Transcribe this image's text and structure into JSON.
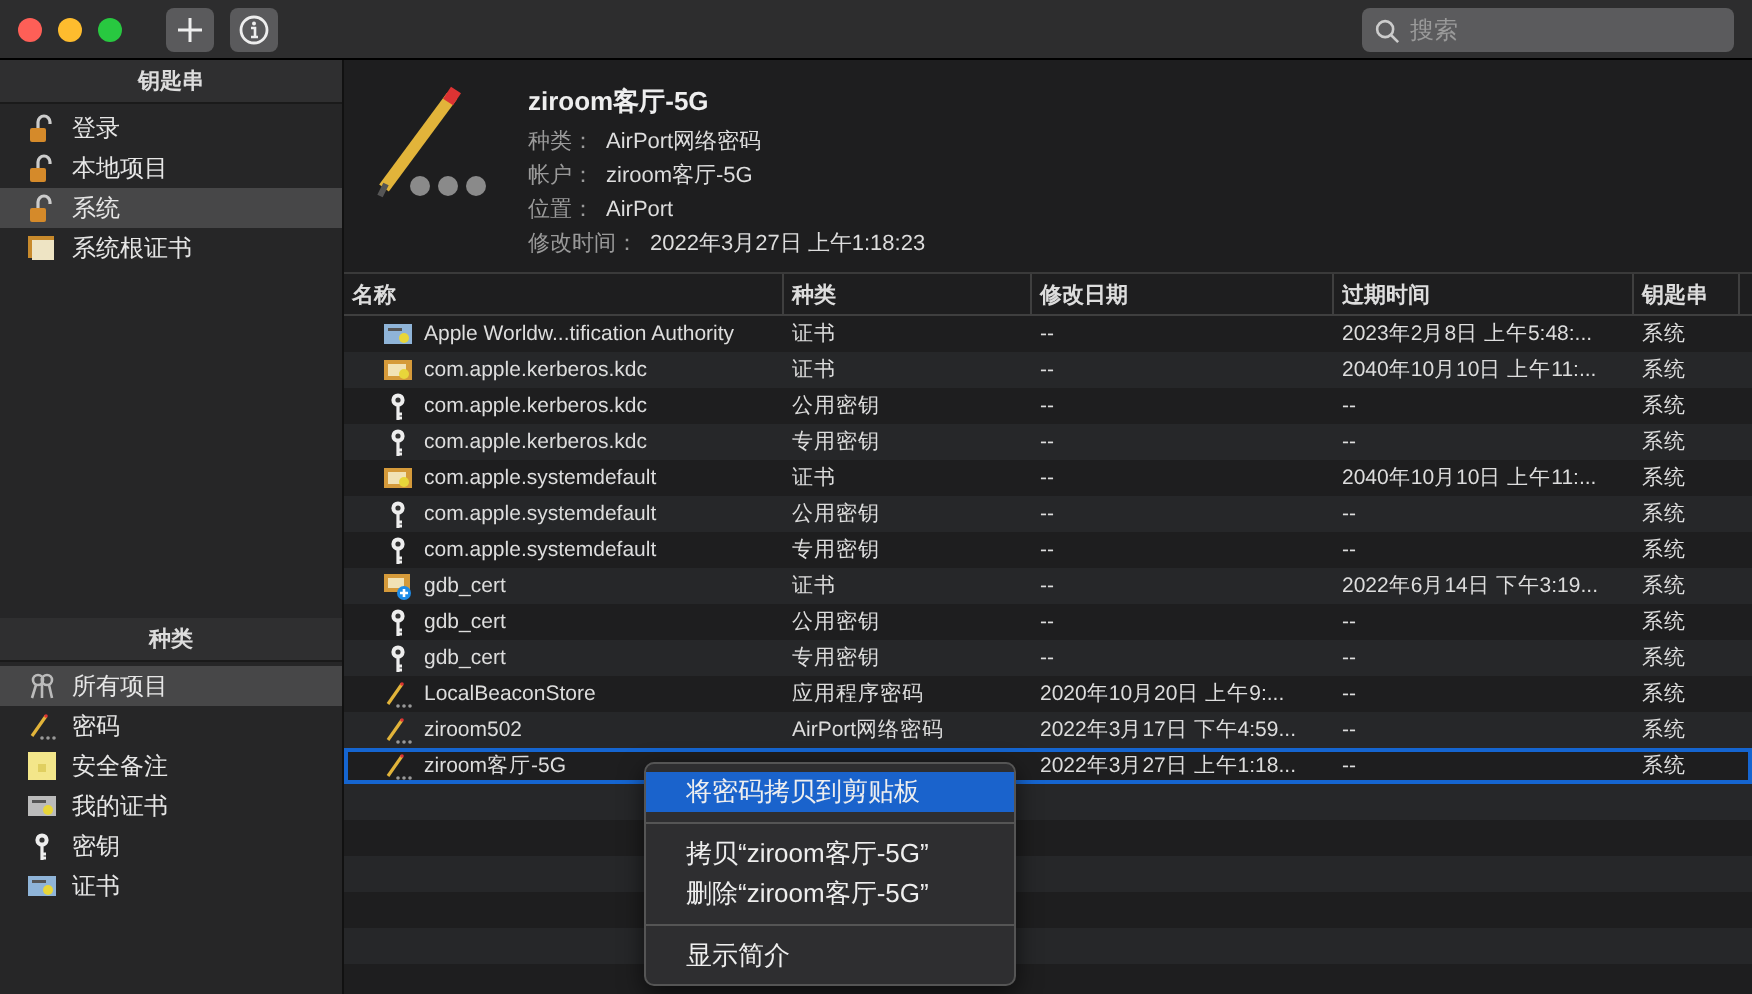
{
  "toolbar": {
    "buttons": [
      {
        "kind": "add"
      },
      {
        "kind": "info"
      }
    ],
    "search": {
      "placeholder": "搜索"
    }
  },
  "keychains": {
    "title": "钥匙串",
    "items": [
      {
        "label": "登录",
        "kind": "lock",
        "selected": false
      },
      {
        "label": "本地项目",
        "kind": "lock",
        "selected": false
      },
      {
        "label": "系统",
        "kind": "lock",
        "selected": true
      },
      {
        "label": "系统根证书",
        "kind": "certs",
        "selected": false
      }
    ]
  },
  "categories": {
    "title": "种类",
    "items": [
      {
        "label": "所有项目",
        "kind": "keys",
        "selected": true
      },
      {
        "label": "密码",
        "kind": "pencil",
        "selected": false
      },
      {
        "label": "安全备注",
        "kind": "note",
        "selected": false
      },
      {
        "label": "我的证书",
        "kind": "mycert",
        "selected": false
      },
      {
        "label": "密钥",
        "kind": "key",
        "selected": false
      },
      {
        "label": "证书",
        "kind": "cert",
        "selected": false
      }
    ]
  },
  "details": {
    "title": "ziroom客厅-5G",
    "fields": [
      {
        "label": "种类：",
        "value": "AirPort网络密码"
      },
      {
        "label": "帐户：",
        "value": "ziroom客厅-5G"
      },
      {
        "label": "位置：",
        "value": "AirPort"
      },
      {
        "label": "修改时间：",
        "value": "2022年3月27日 上午1:18:23"
      }
    ]
  },
  "table": {
    "columns": [
      "名称",
      "种类",
      "修改日期",
      "过期时间",
      "钥匙串"
    ],
    "rows": [
      {
        "kind": "cert",
        "cells": [
          "Apple Worldw...tification Authority",
          "证书",
          "--",
          "2023年2月8日 上午5:48:...",
          "系统"
        ],
        "selected": false
      },
      {
        "kind": "cert-gold",
        "cells": [
          "com.apple.kerberos.kdc",
          "证书",
          "--",
          "2040年10月10日 上午11:...",
          "系统"
        ],
        "selected": false
      },
      {
        "kind": "key",
        "cells": [
          "com.apple.kerberos.kdc",
          "公用密钥",
          "--",
          "--",
          "系统"
        ],
        "selected": false
      },
      {
        "kind": "key",
        "cells": [
          "com.apple.kerberos.kdc",
          "专用密钥",
          "--",
          "--",
          "系统"
        ],
        "selected": false
      },
      {
        "kind": "cert-gold",
        "cells": [
          "com.apple.systemdefault",
          "证书",
          "--",
          "2040年10月10日 上午11:...",
          "系统"
        ],
        "selected": false
      },
      {
        "kind": "key",
        "cells": [
          "com.apple.systemdefault",
          "公用密钥",
          "--",
          "--",
          "系统"
        ],
        "selected": false
      },
      {
        "kind": "key",
        "cells": [
          "com.apple.systemdefault",
          "专用密钥",
          "--",
          "--",
          "系统"
        ],
        "selected": false
      },
      {
        "kind": "cert-plus",
        "cells": [
          "gdb_cert",
          "证书",
          "--",
          "2022年6月14日 下午3:19...",
          "系统"
        ],
        "selected": false
      },
      {
        "kind": "key",
        "cells": [
          "gdb_cert",
          "公用密钥",
          "--",
          "--",
          "系统"
        ],
        "selected": false
      },
      {
        "kind": "key",
        "cells": [
          "gdb_cert",
          "专用密钥",
          "--",
          "--",
          "系统"
        ],
        "selected": false
      },
      {
        "kind": "pencil",
        "cells": [
          "LocalBeaconStore",
          "应用程序密码",
          "2020年10月20日 上午9:...",
          "--",
          "系统"
        ],
        "selected": false
      },
      {
        "kind": "pencil",
        "cells": [
          "ziroom502",
          "AirPort网络密码",
          "2022年3月17日 下午4:59...",
          "--",
          "系统"
        ],
        "selected": false
      },
      {
        "kind": "pencil",
        "cells": [
          "ziroom客厅-5G",
          "",
          "2022年3月27日 上午1:18...",
          "--",
          "系统"
        ],
        "selected": true
      }
    ]
  },
  "context_menu": {
    "groups": [
      [
        {
          "label": "将密码拷贝到剪贴板",
          "selected": true
        }
      ],
      [
        {
          "label": "拷贝“ziroom客厅-5G”",
          "selected": false
        },
        {
          "label": "删除“ziroom客厅-5G”",
          "selected": false
        }
      ],
      [
        {
          "label": "显示简介",
          "selected": false
        }
      ]
    ]
  }
}
